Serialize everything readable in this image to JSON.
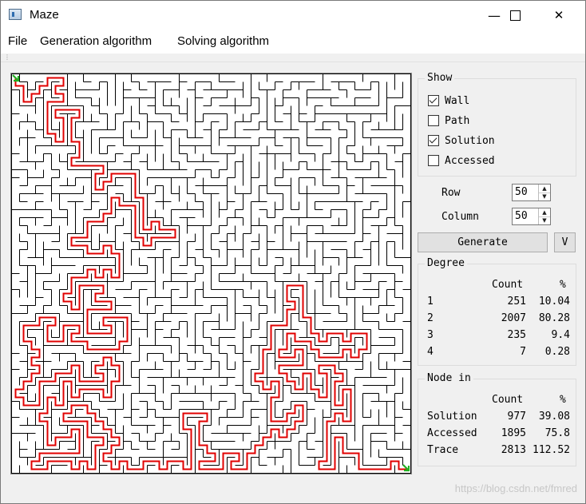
{
  "window": {
    "title": "Maze",
    "minimize_glyph": "—",
    "maximize_glyph": "☐",
    "close_glyph": "✕"
  },
  "menu": [
    "File",
    "Generation algorithm",
    "Solving algorithm"
  ],
  "maze": {
    "rows": 50,
    "columns": 50,
    "wall_color": "#000000",
    "solution_color": "#e00000",
    "marker_color": "#22b022",
    "start_icon": "green-arrow-icon",
    "end_icon": "green-arrow-icon"
  },
  "show": {
    "title": "Show",
    "options": [
      {
        "label": "Wall",
        "checked": true
      },
      {
        "label": "Path",
        "checked": false
      },
      {
        "label": "Solution",
        "checked": true
      },
      {
        "label": "Accessed",
        "checked": false
      }
    ]
  },
  "size": {
    "row_label": "Row",
    "row_value": "50",
    "column_label": "Column",
    "column_value": "50"
  },
  "buttons": {
    "generate": "Generate",
    "v": "V"
  },
  "degree": {
    "title": "Degree",
    "header": [
      "",
      "Count",
      "%"
    ],
    "rows": [
      [
        "1",
        "251",
        "10.04"
      ],
      [
        "2",
        "2007",
        "80.28"
      ],
      [
        "3",
        "235",
        "9.4"
      ],
      [
        "4",
        "7",
        "0.28"
      ]
    ]
  },
  "node_in": {
    "title": "Node in",
    "header": [
      "",
      "Count",
      "%"
    ],
    "rows": [
      [
        "Solution",
        "977",
        "39.08"
      ],
      [
        "Accessed",
        "1895",
        "75.8"
      ],
      [
        "Trace",
        "2813",
        "112.52"
      ]
    ]
  },
  "watermark": "https://blog.csdn.net/fmred"
}
